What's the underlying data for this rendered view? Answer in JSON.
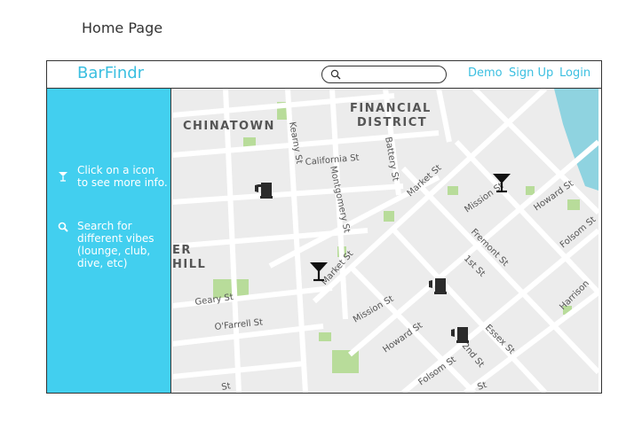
{
  "page": {
    "caption": "Home Page"
  },
  "header": {
    "brand": "BarFindr",
    "search": {
      "placeholder": "",
      "value": ""
    },
    "nav": [
      {
        "label": "Demo"
      },
      {
        "label": "Sign Up"
      },
      {
        "label": "Login"
      }
    ]
  },
  "sidebar": {
    "tips": [
      {
        "icon": "cocktail-glass-icon",
        "text": "Click on a icon to see more info."
      },
      {
        "icon": "search-icon",
        "text": "Search for different vibes (lounge, club, dive, etc)"
      }
    ]
  },
  "map": {
    "districts": [
      "CHINATOWN",
      "FINANCIAL",
      "DISTRICT",
      "ER",
      "HILL"
    ],
    "streets": [
      "Kearny St",
      "California St",
      "Montgomery St",
      "Battery St",
      "Market St",
      "Market St",
      "Mission St",
      "Howard St",
      "Folsom St",
      "Fremont St",
      "1st St",
      "Geary St",
      "O'Farrell St",
      "Mission St",
      "Howard St",
      "Folsom St",
      "2nd St",
      "Essex St",
      "Harrison",
      "St",
      "St"
    ],
    "colors": {
      "background": "#ececec",
      "street": "#ffffff",
      "park": "#b8dc9a",
      "water": "#8fd3e0",
      "marker": "#2b2b2b"
    },
    "markers": [
      {
        "type": "mug-icon"
      },
      {
        "type": "cocktail-glass-icon"
      },
      {
        "type": "cocktail-glass-icon"
      },
      {
        "type": "mug-icon"
      },
      {
        "type": "mug-icon"
      }
    ]
  }
}
